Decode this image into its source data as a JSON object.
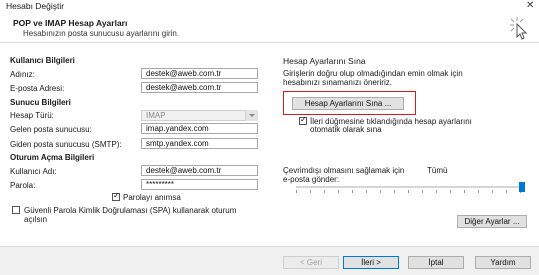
{
  "window": {
    "title": "Hesabı Değiştir",
    "close_glyph": "✕"
  },
  "header": {
    "title": "POP ve IMAP Hesap Ayarları",
    "subtitle": "Hesabınızın posta sunucusu ayarlarını girin."
  },
  "user_info": {
    "section": "Kullanıcı Bilgileri",
    "name_label": "Adınız:",
    "name_value": "destek@aweb.com.tr",
    "email_label": "E-posta Adresi:",
    "email_value": "destek@aweb.com.tr"
  },
  "server_info": {
    "section": "Sunucu Bilgileri",
    "account_type_label": "Hesap Türü:",
    "account_type_value": "IMAP",
    "incoming_label": "Gelen posta sunucusu:",
    "incoming_value": "imap.yandex.com",
    "outgoing_label": "Giden posta sunucusu (SMTP):",
    "outgoing_value": "smtp.yandex.com"
  },
  "login_info": {
    "section": "Oturum Açma Bilgileri",
    "username_label": "Kullanıcı Adı:",
    "username_value": "destek@aweb.com.tr",
    "password_label": "Parola:",
    "password_value": "*********",
    "remember_label": "Parolayı anımsa",
    "remember_checked": true,
    "spa_label_line1": "Güvenli Parola Kimlik Doğrulaması (SPA) kullanarak oturum",
    "spa_label_line2": "açılsın",
    "spa_checked": false
  },
  "test_settings": {
    "section": "Hesap Ayarlarını Sına",
    "desc_line1": "Girişlerin doğru olup olmadığından emin olmak için",
    "desc_line2": "hesabınızı sınamanızı öneririz.",
    "test_button": "Hesap Ayarlarını Sına ...",
    "auto_test_line1": "İleri düğmesine tıklandığında hesap ayarlarını",
    "auto_test_line2": "otomatik olarak sına",
    "auto_test_checked": true
  },
  "offline": {
    "label_line1": "Çevrimdışı olmasını sağlamak için",
    "label_line2": "e-posta gönder:",
    "value": "Tümü",
    "slider_level": 1.0
  },
  "more_settings_button": "Diğer Ayarlar ...",
  "footer": {
    "back": "< Geri",
    "next": "İleri >",
    "cancel": "İptal",
    "help": "Yardım"
  },
  "colors": {
    "accent": "#0078d7",
    "highlight_border": "#d61b1b"
  }
}
